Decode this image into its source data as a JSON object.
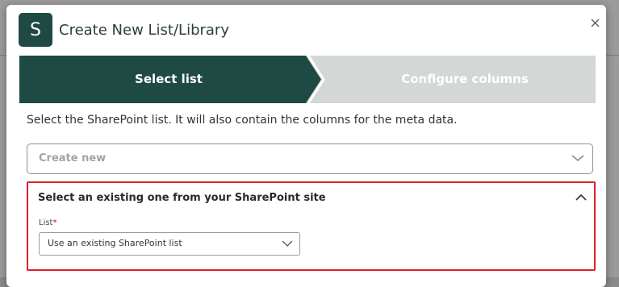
{
  "dialog": {
    "logo_letter": "S",
    "title": "Create New List/Library",
    "close_icon": "close-icon"
  },
  "steps": [
    {
      "label": "Select list",
      "active": true
    },
    {
      "label": "Configure columns",
      "active": false
    }
  ],
  "description": "Select the SharePoint list. It will also contain the columns for the meta data.",
  "create_select": {
    "value": "Create new"
  },
  "existing_panel": {
    "title": "Select an existing one from your SharePoint site",
    "field_label": "List",
    "required_mark": "*",
    "select_value": "Use an existing SharePoint list"
  },
  "colors": {
    "accent_dark": "#1f4a43",
    "step_inactive": "#d3d8d6",
    "highlight": "#e0212b"
  }
}
